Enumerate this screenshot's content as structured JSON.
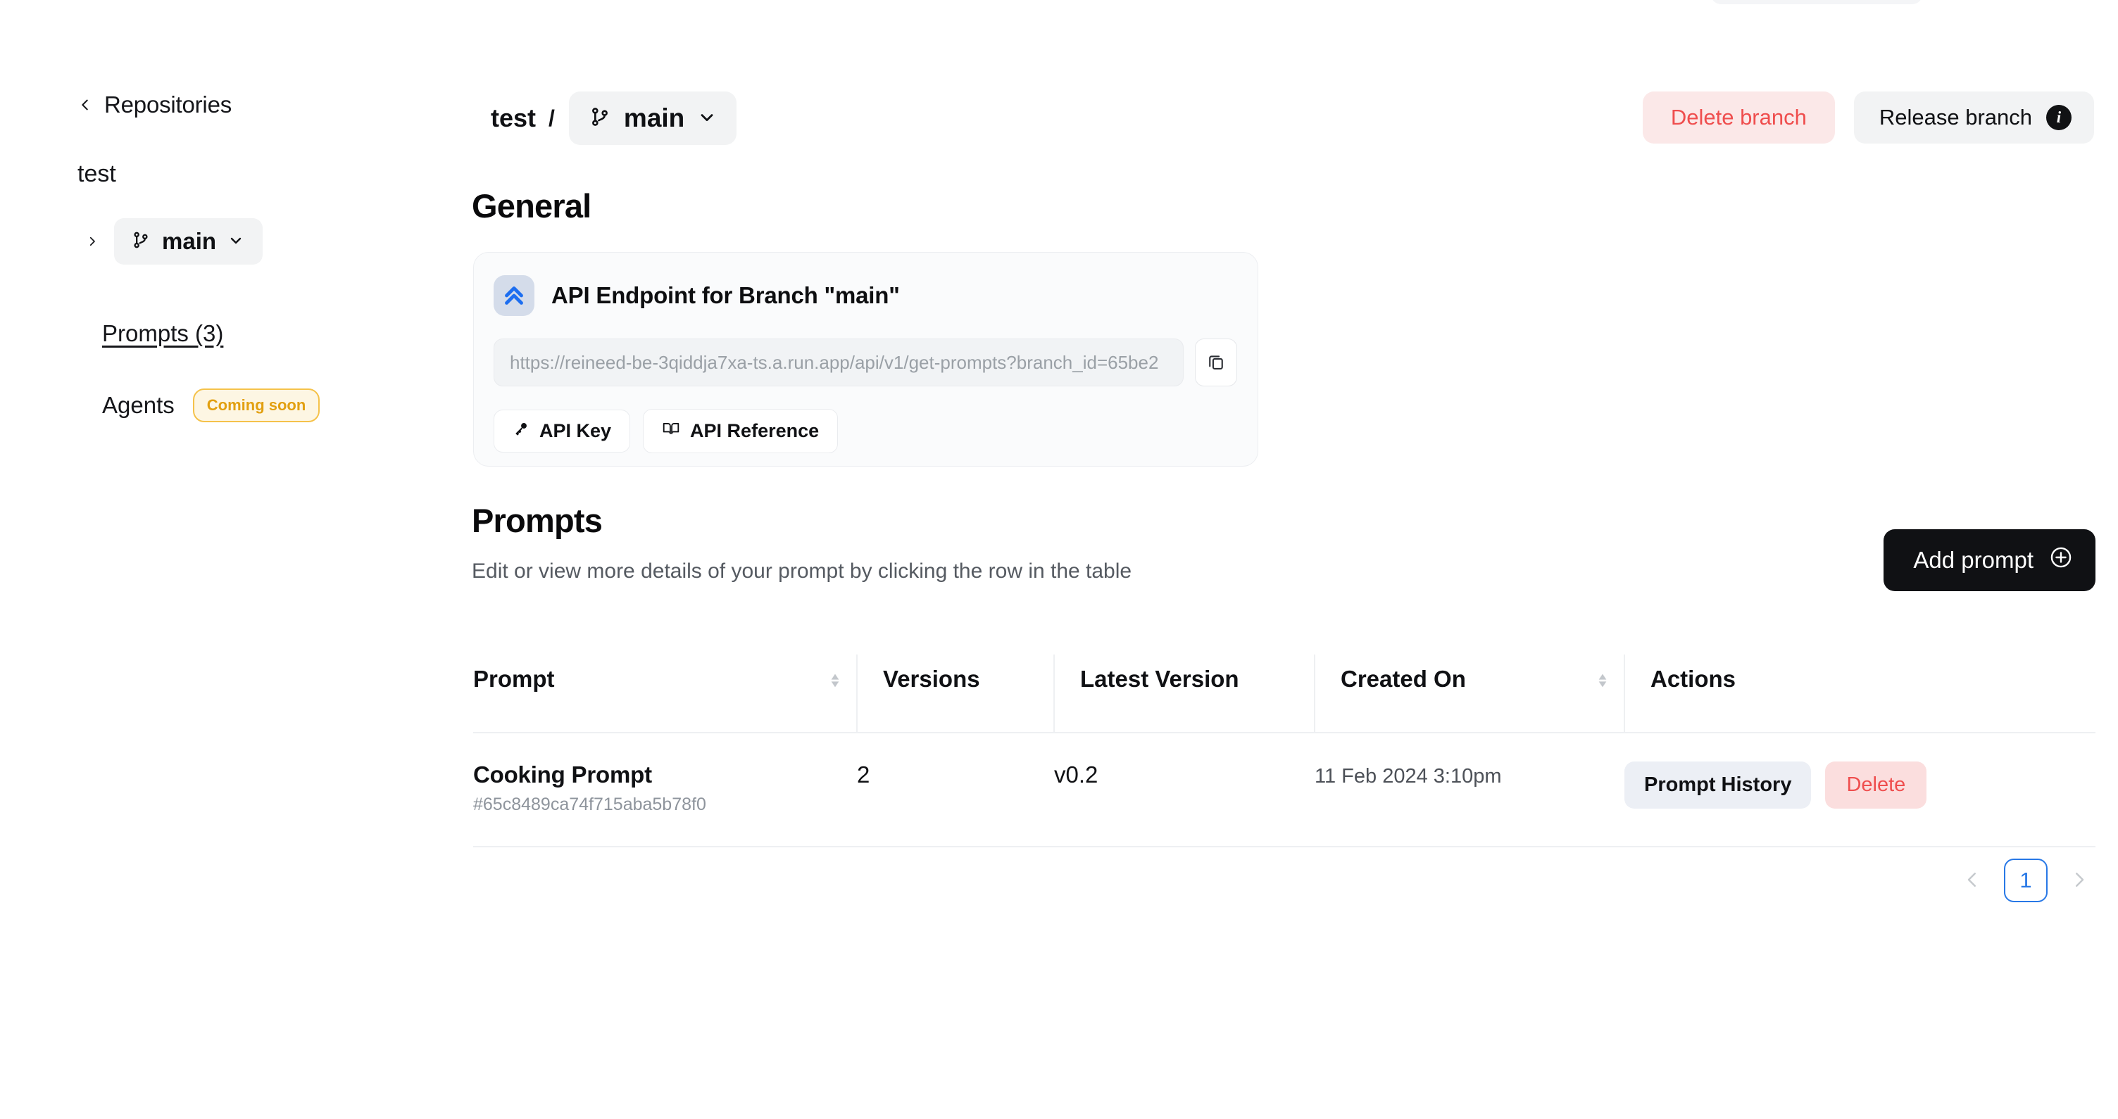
{
  "sidebar": {
    "back_label": "Repositories",
    "repo_name": "test",
    "branch_label": "main",
    "nav_prompts": "Prompts (3)",
    "nav_agents": "Agents",
    "agents_badge": "Coming soon",
    "badge_color": "#e2a011"
  },
  "header": {
    "breadcrumb_repo": "test",
    "breadcrumb_separator": "/",
    "breadcrumb_branch": "main",
    "delete_branch_label": "Delete branch",
    "release_branch_label": "Release branch",
    "info_glyph": "i",
    "danger_color": "#ef4e4e"
  },
  "general": {
    "section_title": "General",
    "card_title": "API Endpoint for Branch \"main\"",
    "url_placeholder": "https://reineed-be-3qiddja7xa-ts.a.run.app/api/v1/get-prompts?branch_id=65be2",
    "url_value": "",
    "api_key_label": "API Key",
    "api_reference_label": "API Reference",
    "accent_color": "#1d6ef0"
  },
  "prompts": {
    "section_title": "Prompts",
    "section_subtitle": "Edit or view more details of your prompt by clicking the row in the table",
    "add_prompt_label": "Add prompt",
    "columns": {
      "prompt": "Prompt",
      "versions": "Versions",
      "latest_version": "Latest Version",
      "created_on": "Created On",
      "actions": "Actions"
    },
    "rows": [
      {
        "title": "Cooking Prompt",
        "hash": "#65c8489ca74f715aba5b78f0",
        "versions": "2",
        "latest_version": "v0.2",
        "created_on": "11 Feb 2024 3:10pm",
        "history_label": "Prompt History",
        "delete_label": "Delete"
      }
    ],
    "pagination": {
      "current_page": "1",
      "prev_label": "‹",
      "next_label": "›",
      "active_color": "#2878e6"
    }
  }
}
